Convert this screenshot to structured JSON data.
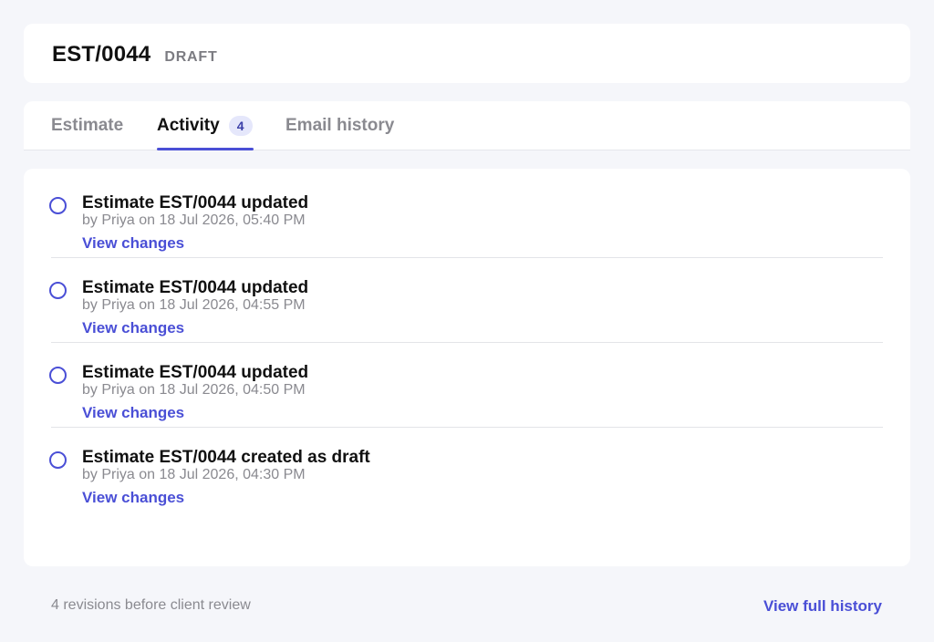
{
  "header": {
    "doc_id": "EST/0044",
    "status": "DRAFT"
  },
  "tabs": [
    {
      "label": "Estimate",
      "active": false
    },
    {
      "label": "Activity",
      "active": true,
      "badge": "4"
    },
    {
      "label": "Email history",
      "active": false
    }
  ],
  "activity": [
    {
      "title": "Estimate EST/0044 updated",
      "meta": "by Priya on 18 Jul 2026, 05:40 PM",
      "link": "View changes"
    },
    {
      "title": "Estimate EST/0044 updated",
      "meta": "by Priya on 18 Jul 2026, 04:55 PM",
      "link": "View changes"
    },
    {
      "title": "Estimate EST/0044 updated",
      "meta": "by Priya on 18 Jul 2026, 04:50 PM",
      "link": "View changes"
    },
    {
      "title": "Estimate EST/0044 created as draft",
      "meta": "by Priya on 18 Jul 2026, 04:30 PM",
      "link": "View changes"
    }
  ],
  "footer": {
    "note": "4 revisions before client review",
    "link": "View full history"
  },
  "colors": {
    "accent": "#4a4fd6",
    "background": "#f5f6fa",
    "muted_text": "#8a8a90",
    "badge_bg": "#e5e7fb"
  },
  "icons": {
    "activity_marker": "circle-outline-icon"
  }
}
